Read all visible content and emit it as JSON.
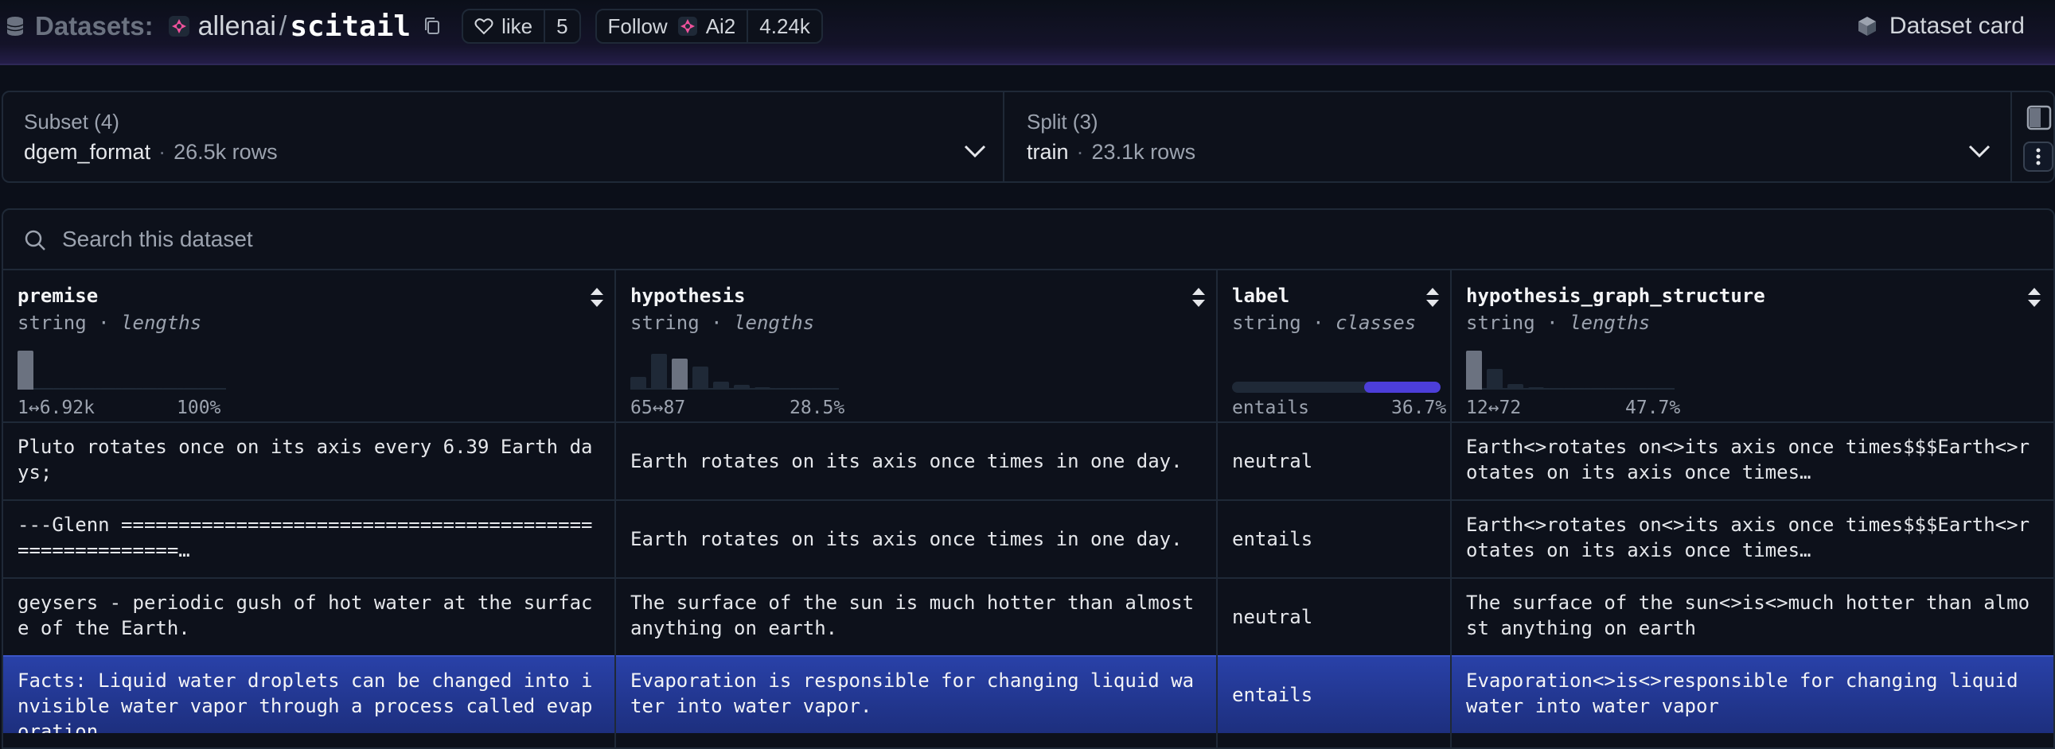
{
  "header": {
    "datasets_label": "Datasets:",
    "org": "allenai",
    "slash": "/",
    "repo": "scitail",
    "like_label": "like",
    "like_count": "5",
    "follow_label": "Follow",
    "follow_org": "Ai2",
    "follower_count": "4.24k",
    "dataset_card_label": "Dataset card"
  },
  "subset": {
    "title": "Subset (4)",
    "value": "dgem_format",
    "dot": "·",
    "rows": "26.5k rows"
  },
  "split": {
    "title": "Split (3)",
    "value": "train",
    "dot": "·",
    "rows": "23.1k rows"
  },
  "search": {
    "placeholder": "Search this dataset"
  },
  "columns": [
    {
      "name": "premise",
      "type": "string",
      "sep": " · ",
      "stat_kind": "lengths",
      "range": "1↔6.92k",
      "pct": "100%",
      "hist": [
        0.85,
        0,
        0,
        0,
        0,
        0.04,
        0.03,
        0.02,
        0.02
      ],
      "highlight": 0
    },
    {
      "name": "hypothesis",
      "type": "string",
      "sep": " · ",
      "stat_kind": "lengths",
      "range": "65↔87",
      "pct": "28.5%",
      "hist": [
        0.28,
        0.78,
        0.68,
        0.5,
        0.18,
        0.1,
        0.06,
        0.04,
        0.03,
        0.03
      ],
      "highlight": 2
    },
    {
      "name": "label",
      "type": "string",
      "sep": " · ",
      "stat_kind": "classes",
      "range": "entails",
      "pct": "36.7%",
      "class_fraction": 0.367
    },
    {
      "name": "hypothesis_graph_structure",
      "type": "string",
      "sep": " · ",
      "stat_kind": "lengths",
      "range": "12↔72",
      "pct": "47.7%",
      "hist": [
        0.85,
        0.45,
        0.12,
        0.06,
        0.04,
        0.04,
        0.04,
        0.03,
        0.02
      ],
      "highlight": 0
    }
  ],
  "rows": [
    {
      "premise": "Pluto rotates once on its axis every 6.39 Earth days;",
      "hypothesis": "Earth rotates on its axis once times in one day.",
      "label": "neutral",
      "graph": "Earth<>rotates on<>its axis once times$$$Earth<>rotates on its axis once times…"
    },
    {
      "premise": "---Glenn =======================================================…",
      "hypothesis": "Earth rotates on its axis once times in one day.",
      "label": "entails",
      "graph": "Earth<>rotates on<>its axis once times$$$Earth<>rotates on its axis once times…"
    },
    {
      "premise": "geysers - periodic gush of hot water at the surface of the Earth.",
      "hypothesis": "The surface of the sun is much hotter than almost anything on earth.",
      "label": "neutral",
      "graph": "The surface of the sun<>is<>much hotter than almost anything on earth"
    },
    {
      "premise": "Facts: Liquid water droplets can be changed into invisible water vapor through a process called evaporation .",
      "hypothesis": "Evaporation is responsible for changing liquid water into water vapor.",
      "label": "entails",
      "graph": "Evaporation<>is<>responsible for changing liquid water into water vapor"
    }
  ],
  "colors": {
    "background": "#0b0f19",
    "accent": "#4c3ed9",
    "selected_row": "#2941a8"
  }
}
